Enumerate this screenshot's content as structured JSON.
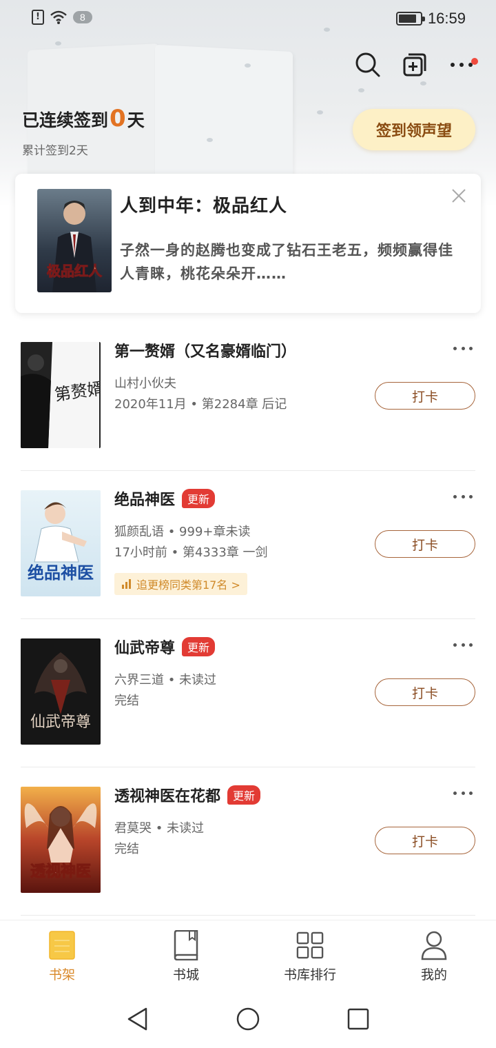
{
  "status_bar": {
    "alert_symbol": "!",
    "notification_count": "8",
    "battery_level": 0.85,
    "time": "16:59"
  },
  "top_actions": {
    "icons": [
      "search-icon",
      "add-to-shelf-icon",
      "more-icon"
    ],
    "has_red_dot": true
  },
  "checkin": {
    "prefix": "已连续签到",
    "days": "0",
    "suffix": "天",
    "total": "累计签到2天",
    "button_label": "签到领声望"
  },
  "recommend": {
    "title": "人到中年：极品红人",
    "description": "子然一身的赵腾也变成了钻石王老五，频频赢得佳人青睐，桃花朵朵开……",
    "cover_text": "极品红人"
  },
  "books": [
    {
      "title": "第一赘婿（又名豪婿临门）",
      "has_update_tag": false,
      "meta1": "山村小伙夫",
      "meta2": "2020年11月 • 第2284章 后记",
      "cover_text": "第赘婿",
      "cover_colors": [
        "#f4f4f4",
        "#2a2a2a"
      ],
      "button_label": "打卡"
    },
    {
      "title": "绝品神医",
      "has_update_tag": true,
      "update_label": "更新",
      "meta1": "狐颜乱语 • 999+章未读",
      "meta2": "17小时前 • 第4333章 一剑",
      "rank_label": "追更榜同类第17名 >",
      "cover_text": "绝品神医",
      "cover_colors": [
        "#dfeef7",
        "#1d4fa3"
      ],
      "button_label": "打卡"
    },
    {
      "title": "仙武帝尊",
      "has_update_tag": true,
      "update_label": "更新",
      "meta1": "六界三道 • 未读过",
      "meta2": "完结",
      "cover_text": "仙武帝尊",
      "cover_colors": [
        "#1c1c1c",
        "#b83326"
      ],
      "button_label": "打卡"
    },
    {
      "title": "透视神医在花都",
      "has_update_tag": true,
      "update_label": "更新",
      "meta1": "君莫哭 • 未读过",
      "meta2": "完结",
      "cover_text": "透视神医",
      "cover_colors": [
        "#7a1d14",
        "#f2b04a"
      ],
      "button_label": "打卡"
    }
  ],
  "tabs": [
    {
      "label": "书架",
      "icon": "bookshelf-icon",
      "active": true
    },
    {
      "label": "书城",
      "icon": "book-icon",
      "active": false
    },
    {
      "label": "书库排行",
      "icon": "grid-icon",
      "active": false
    },
    {
      "label": "我的",
      "icon": "user-icon",
      "active": false
    }
  ],
  "colors": {
    "accent": "#d9892a",
    "checkin_days": "#e27323",
    "update_tag": "#e23b34",
    "punch_border": "#a6643a"
  }
}
